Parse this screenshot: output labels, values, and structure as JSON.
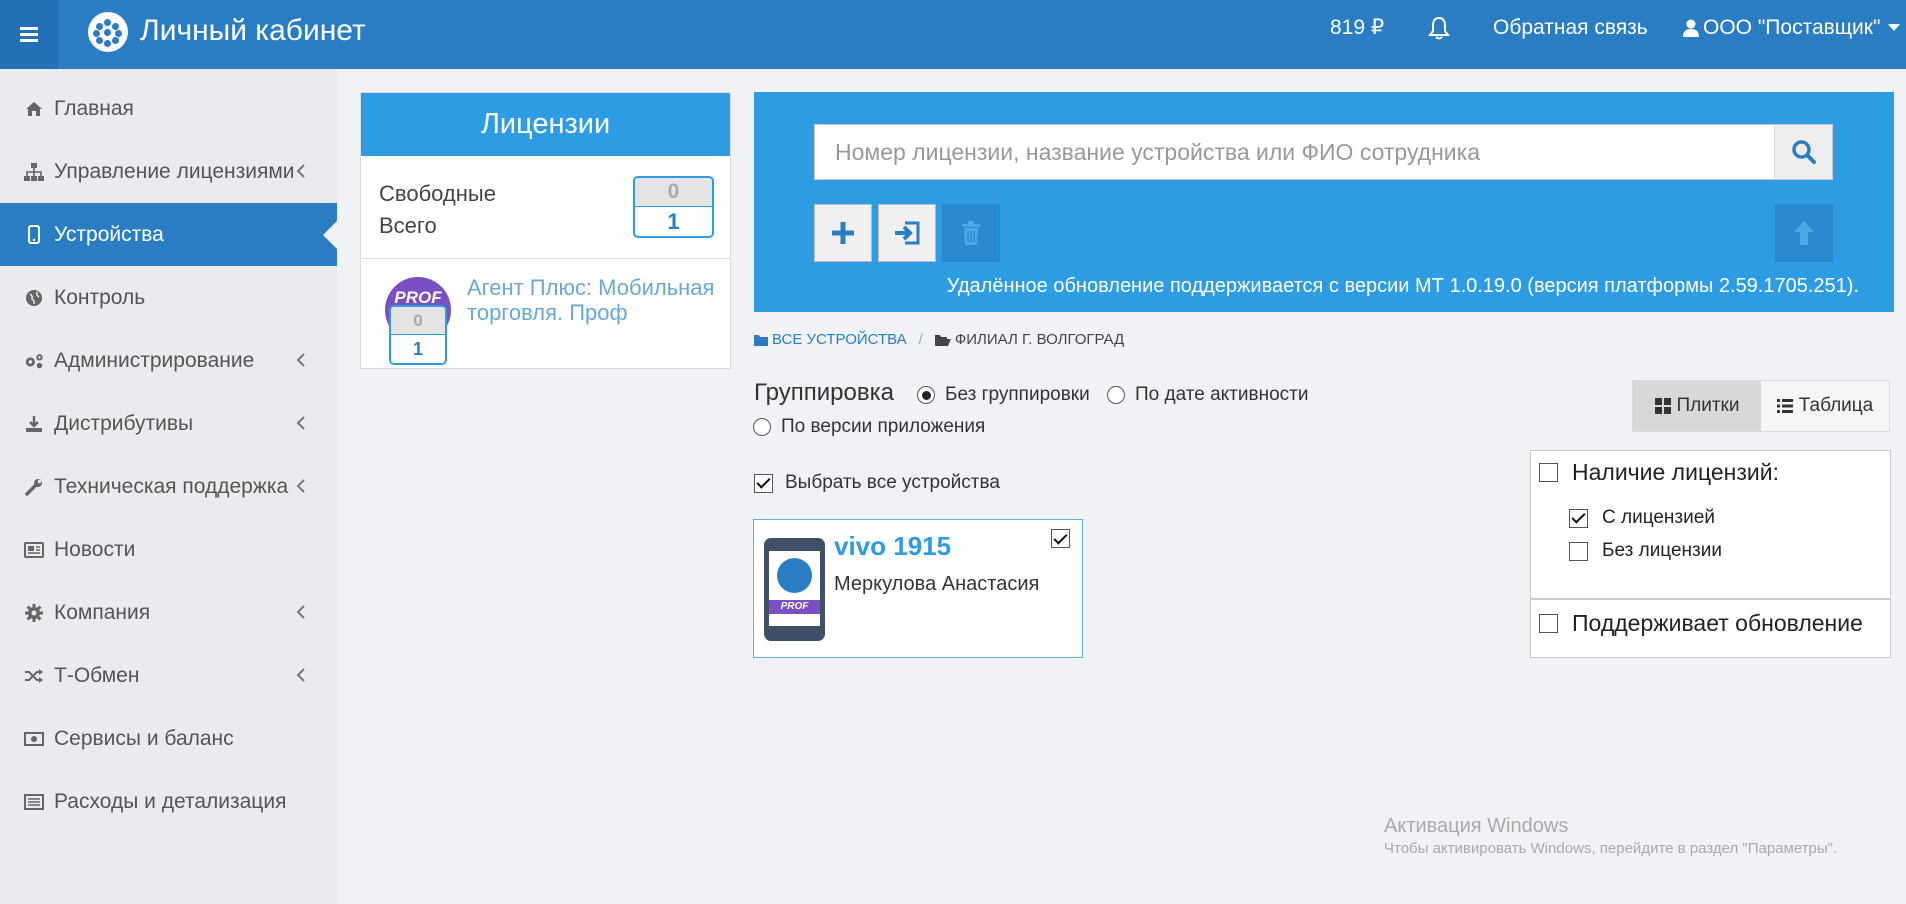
{
  "header": {
    "title": "Личный кабинет",
    "balance": "819 ₽",
    "feedback": "Обратная связь",
    "account": "ООО \"Поставщик\""
  },
  "sidebar": {
    "items": [
      {
        "label": "Главная",
        "icon": "home-icon"
      },
      {
        "label": "Управление лицензиями",
        "icon": "sitemap-icon"
      },
      {
        "label": "Устройства",
        "icon": "mobile-icon"
      },
      {
        "label": "Контроль",
        "icon": "globe-icon"
      },
      {
        "label": "Администрирование",
        "icon": "gears-icon"
      },
      {
        "label": "Дистрибутивы",
        "icon": "download-icon"
      },
      {
        "label": "Техническая поддержка",
        "icon": "wrench-icon"
      },
      {
        "label": "Новости",
        "icon": "newspaper-icon"
      },
      {
        "label": "Компания",
        "icon": "gear-icon"
      },
      {
        "label": "Т-Обмен",
        "icon": "random-icon"
      },
      {
        "label": "Сервисы и баланс",
        "icon": "money-icon"
      },
      {
        "label": "Расходы и детализация",
        "icon": "list-alt-icon"
      }
    ]
  },
  "licenses": {
    "title": "Лицензии",
    "free_label": "Свободные",
    "total_label": "Всего",
    "free_count": "0",
    "total_count": "1",
    "product": {
      "badge": "PROF",
      "name": "Агент Плюс: Мобильная торговля. Проф",
      "free": "0",
      "total": "1"
    }
  },
  "search": {
    "placeholder": "Номер лицензии, название устройства или ФИО сотрудника",
    "notice": "Удалённое обновление поддерживается с версии МТ 1.0.19.0 (версия платформы 2.59.1705.251)."
  },
  "breadcrumb": {
    "root": "ВСЕ УСТРОЙСТВА",
    "current": "ФИЛИАЛ Г. ВОЛГОГРАД"
  },
  "grouping": {
    "title": "Группировка",
    "options": [
      "Без группировки",
      "По дате активности",
      "По версии приложения"
    ],
    "selected": "Без группировки"
  },
  "view_toggle": {
    "tiles": "Плитки",
    "table": "Таблица"
  },
  "select_all": "Выбрать все устройства",
  "device": {
    "name": "vivo 1915",
    "owner": "Меркулова Анастасия",
    "badge": "PROF"
  },
  "filters": {
    "license_title": "Наличие лицензий:",
    "with_license": "С лицензией",
    "without_license": "Без лицензии",
    "supports_update": "Поддерживает обновление"
  },
  "watermark": {
    "title": "Активация Windows",
    "subtitle": "Чтобы активировать Windows, перейдите в раздел \"Параметры\"."
  },
  "colors": {
    "header": "#2a7dc3",
    "accent": "#2d9ce3",
    "prof": "#7b4fc4"
  }
}
